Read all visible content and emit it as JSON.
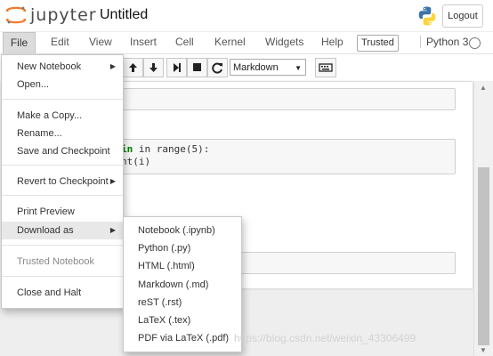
{
  "header": {
    "wordmark": "jupyter",
    "notebook_title": "Untitled",
    "logout_label": "Logout",
    "logo_color": "#f37726"
  },
  "menubar": {
    "items": [
      "File",
      "Edit",
      "View",
      "Insert",
      "Cell",
      "Kernel",
      "Widgets",
      "Help"
    ],
    "trusted_badge": "Trusted",
    "kernel_name": "Python 3"
  },
  "toolbar": {
    "cell_type": "Markdown"
  },
  "notebook": {
    "code_line1_a": "in range(5):",
    "code_line2_a": "nt(i)"
  },
  "file_menu": {
    "items": [
      {
        "label": "New Notebook",
        "submenu": true
      },
      {
        "label": "Open..."
      },
      {
        "label": "Make a Copy..."
      },
      {
        "label": "Rename..."
      },
      {
        "label": "Save and Checkpoint"
      },
      {
        "label": "Revert to Checkpoint",
        "submenu": true
      },
      {
        "label": "Print Preview"
      },
      {
        "label": "Download as",
        "submenu": true
      },
      {
        "label": "Trusted Notebook",
        "disabled": true
      },
      {
        "label": "Close and Halt"
      }
    ]
  },
  "download_submenu": {
    "items": [
      "Notebook (.ipynb)",
      "Python (.py)",
      "HTML (.html)",
      "Markdown (.md)",
      "reST (.rst)",
      "LaTeX (.tex)",
      "PDF via LaTeX (.pdf)"
    ]
  },
  "watermark": "https://blog.csdn.net/weixin_43306499"
}
